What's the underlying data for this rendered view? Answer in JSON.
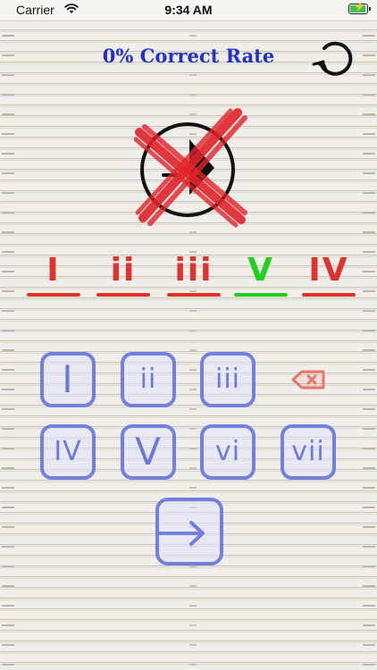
{
  "status_bar": {
    "carrier": "Carrier",
    "time": "9:34 AM",
    "battery_icon": "battery-charging-icon"
  },
  "header": {
    "title": "0% Correct Rate",
    "reset_icon": "refresh-icon"
  },
  "note_display": {
    "icon": "note-head-icon",
    "result_icon": "red-x-icon"
  },
  "answer_sequence": [
    {
      "label": "I",
      "color": "#e0312c"
    },
    {
      "label": "ii",
      "color": "#e0312c"
    },
    {
      "label": "iii",
      "color": "#e0312c"
    },
    {
      "label": "V",
      "color": "#22d01d"
    },
    {
      "label": "IV",
      "color": "#e0312c"
    }
  ],
  "keypad": {
    "row1": [
      "I",
      "ii",
      "iii"
    ],
    "row2": [
      "IV",
      "V",
      "vi",
      "vii"
    ],
    "delete_icon": "backspace-icon",
    "enter_icon": "enter-arrow-icon",
    "key_color": "#7380df",
    "delete_color": "#e8746c"
  }
}
